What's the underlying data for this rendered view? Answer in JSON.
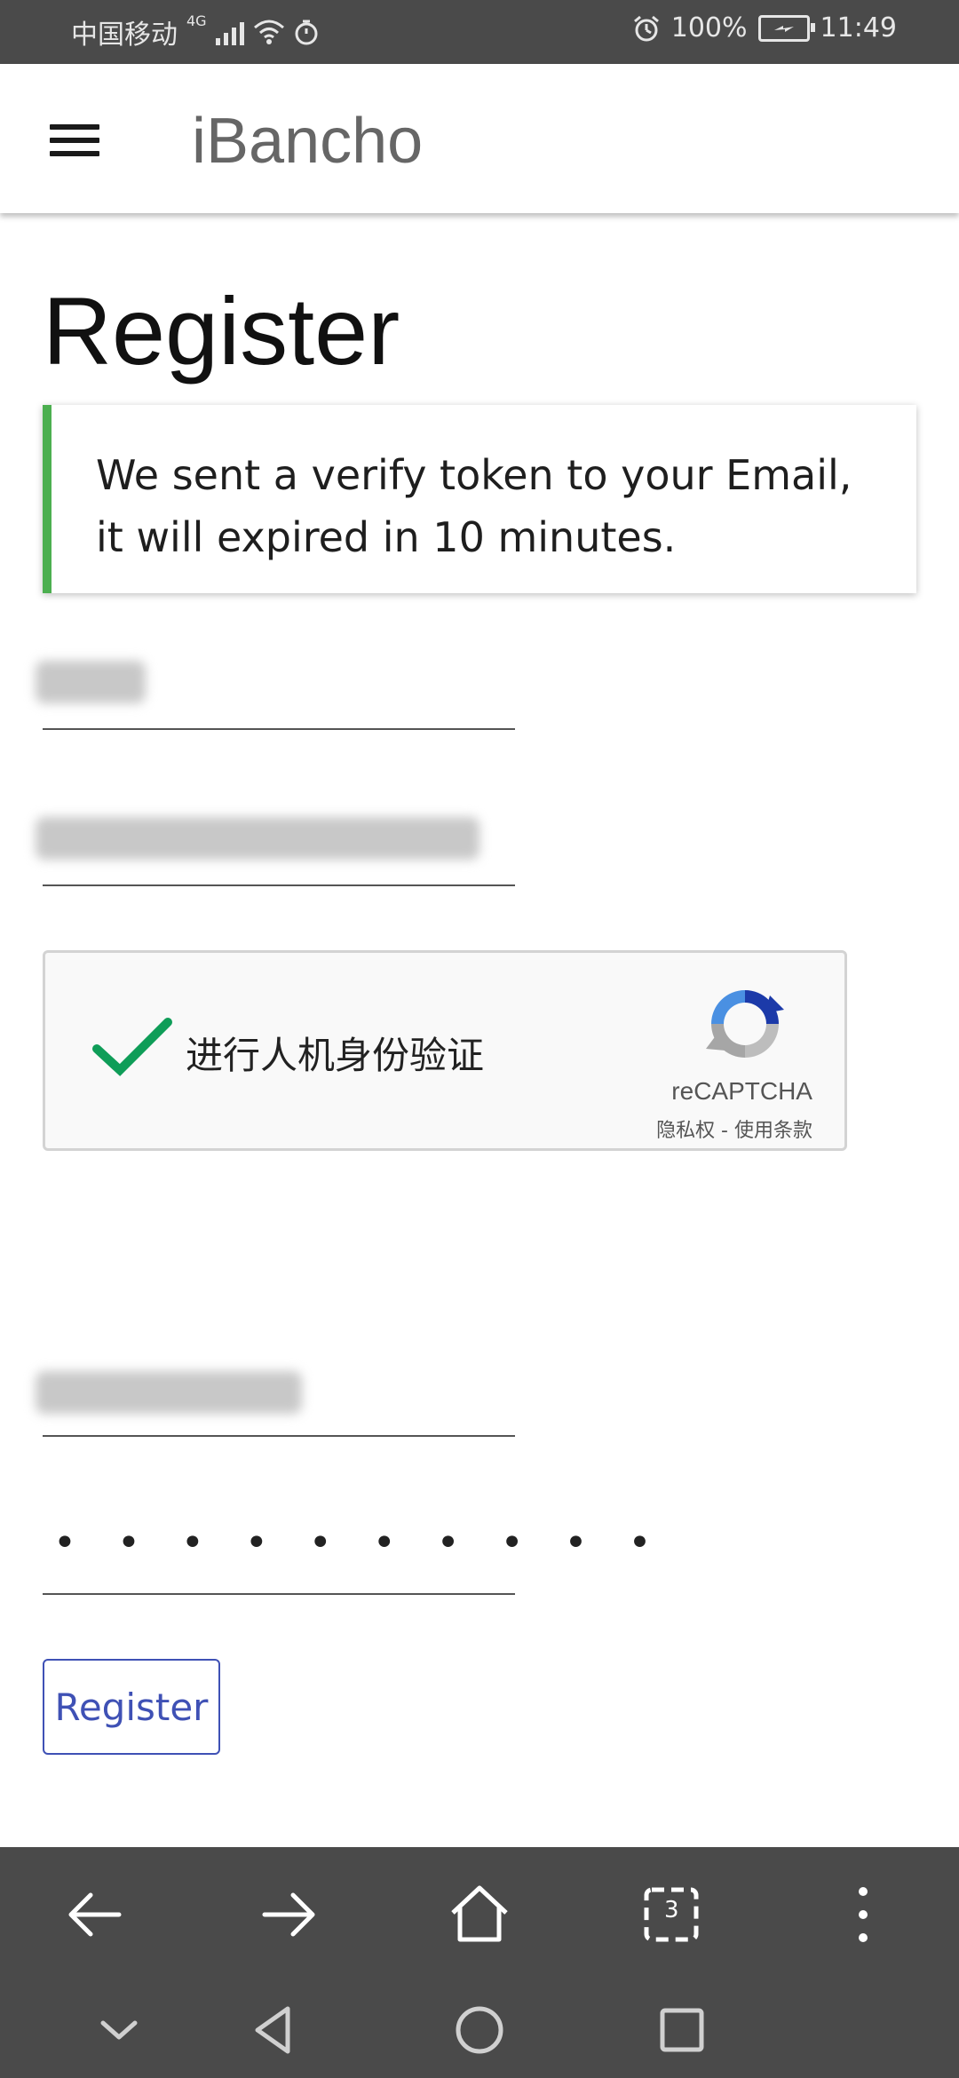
{
  "status_bar": {
    "carrier": "中国移动",
    "network": "4G",
    "battery": "100%",
    "time": "11:49"
  },
  "app_bar": {
    "title": "iBancho",
    "menu_icon": "hamburger-menu-icon"
  },
  "page": {
    "title": "Register",
    "notice": "We sent a verify token to your Email, it will expired in 10 minutes.",
    "notice_accent": "#4caf50"
  },
  "form": {
    "password_mask": "• • • • • • • • • •",
    "recaptcha": {
      "label": "进行人机身份验证",
      "brand": "reCAPTCHA",
      "links": "隐私权 - 使用条款",
      "checked": true
    },
    "submit_label": "Register",
    "submit_color": "#3f51b5"
  },
  "browser_bar": {
    "icons": [
      "back-arrow-icon",
      "forward-arrow-icon",
      "home-icon",
      "tabs-icon",
      "more-vertical-icon"
    ],
    "tab_count": "3"
  },
  "system_nav": {
    "icons": [
      "chevron-down-icon",
      "back-triangle-icon",
      "home-circle-icon",
      "recents-square-icon"
    ]
  }
}
